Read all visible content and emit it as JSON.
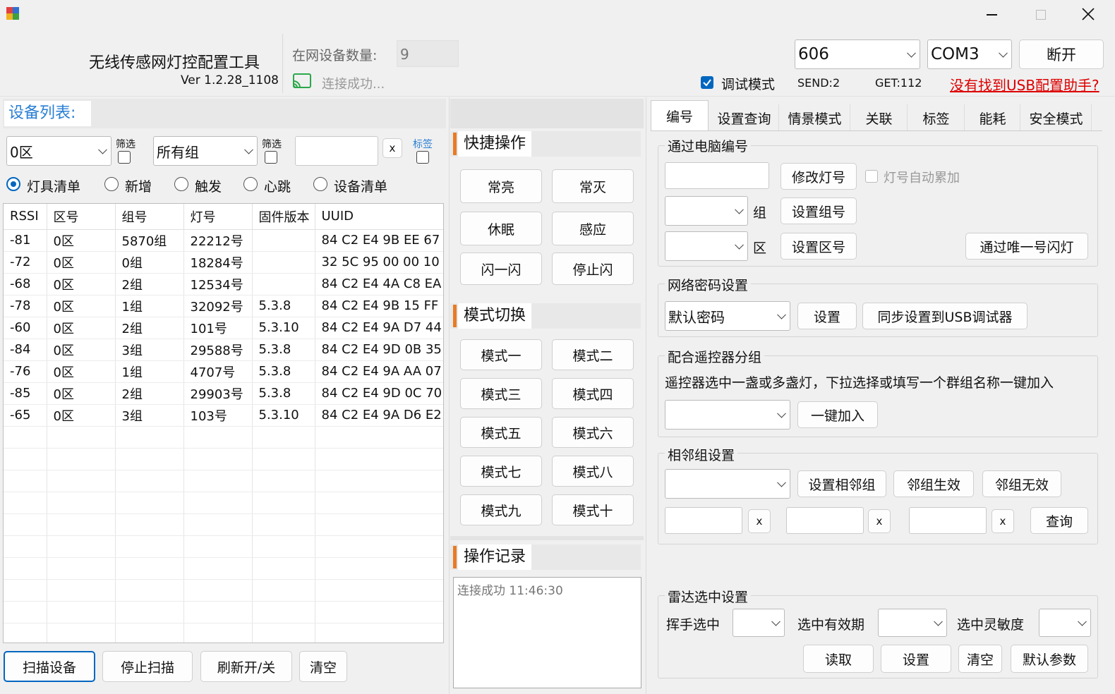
{
  "window": {
    "app_title": "无线传感网灯控配置工具",
    "version": "Ver 1.2.28_1108",
    "minimize": "—",
    "close": "✕"
  },
  "header": {
    "online_label": "在网设备数量:",
    "online_count": "9",
    "conn_status": "连接成功...",
    "device_select": "606",
    "port_select": "COM3",
    "disconnect": "断开",
    "debug_mode": "调试模式",
    "send": "SEND:2",
    "get": "GET:112",
    "usb_link": "没有找到USB配置助手?"
  },
  "left": {
    "title": "设备列表:",
    "zone_select": "0区",
    "filter1": "筛选",
    "group_select": "所有组",
    "filter2": "筛选",
    "clear_x": "x",
    "tag": "标签",
    "radios": [
      "灯具清单",
      "新增",
      "触发",
      "心跳",
      "设备清单"
    ],
    "columns": [
      "RSSI",
      "区号",
      "组号",
      "灯号",
      "固件版本",
      "UUID"
    ],
    "rows": [
      [
        "-81",
        "0区",
        "5870组",
        "22212号",
        "",
        "84 C2 E4 9B EE 67"
      ],
      [
        "-72",
        "0区",
        "0组",
        "18284号",
        "",
        "32 5C 95 00 00 10"
      ],
      [
        "-68",
        "0区",
        "2组",
        "12534号",
        "",
        "84 C2 E4 4A C8 EA"
      ],
      [
        "-78",
        "0区",
        "1组",
        "32092号",
        "5.3.8",
        "84 C2 E4 9B 15 FF"
      ],
      [
        "-60",
        "0区",
        "2组",
        "101号",
        "5.3.10",
        "84 C2 E4 9A D7 44"
      ],
      [
        "-84",
        "0区",
        "3组",
        "29588号",
        "5.3.8",
        "84 C2 E4 9D 0B 35"
      ],
      [
        "-76",
        "0区",
        "1组",
        "4707号",
        "5.3.8",
        "84 C2 E4 9A AA 07"
      ],
      [
        "-85",
        "0区",
        "2组",
        "29903号",
        "5.3.8",
        "84 C2 E4 9D 0C 70"
      ],
      [
        "-65",
        "0区",
        "3组",
        "103号",
        "5.3.10",
        "84 C2 E4 9A D6 E2"
      ]
    ],
    "buttons": [
      "扫描设备",
      "停止扫描",
      "刷新开/关",
      "清空"
    ]
  },
  "middle": {
    "quick_title": "快捷操作",
    "quick_buttons": [
      "常亮",
      "常灭",
      "休眠",
      "感应",
      "闪一闪",
      "停止闪"
    ],
    "mode_title": "模式切换",
    "mode_buttons": [
      "模式一",
      "模式二",
      "模式三",
      "模式四",
      "模式五",
      "模式六",
      "模式七",
      "模式八",
      "模式九",
      "模式十"
    ],
    "log_title": "操作记录",
    "log_text": "连接成功 11:46:30"
  },
  "right": {
    "tabs": [
      "编号",
      "设置查询",
      "情景模式",
      "关联",
      "标签",
      "能耗",
      "安全模式"
    ],
    "pc_number": {
      "title": "通过电脑编号",
      "modify_lamp": "修改灯号",
      "auto_inc": "灯号自动累加",
      "group_unit": "组",
      "set_group": "设置组号",
      "zone_unit": "区",
      "set_zone": "设置区号",
      "flash_by_uid": "通过唯一号闪灯"
    },
    "network": {
      "title": "网络密码设置",
      "password_select": "默认密码",
      "set": "设置",
      "sync": "同步设置到USB调试器"
    },
    "remote": {
      "title": "配合遥控器分组",
      "desc": "遥控器选中一盏或多盏灯，下拉选择或填写一个群组名称一键加入",
      "join": "一键加入"
    },
    "adjacent": {
      "title": "相邻组设置",
      "set_adjacent": "设置相邻组",
      "enable": "邻组生效",
      "disable": "邻组无效",
      "x": "x",
      "query": "查询"
    },
    "radar": {
      "title": "雷达选中设置",
      "wave": "挥手选中",
      "valid_period": "选中有效期",
      "sensitivity": "选中灵敏度",
      "read": "读取",
      "set": "设置",
      "clear": "清空",
      "default": "默认参数"
    }
  }
}
